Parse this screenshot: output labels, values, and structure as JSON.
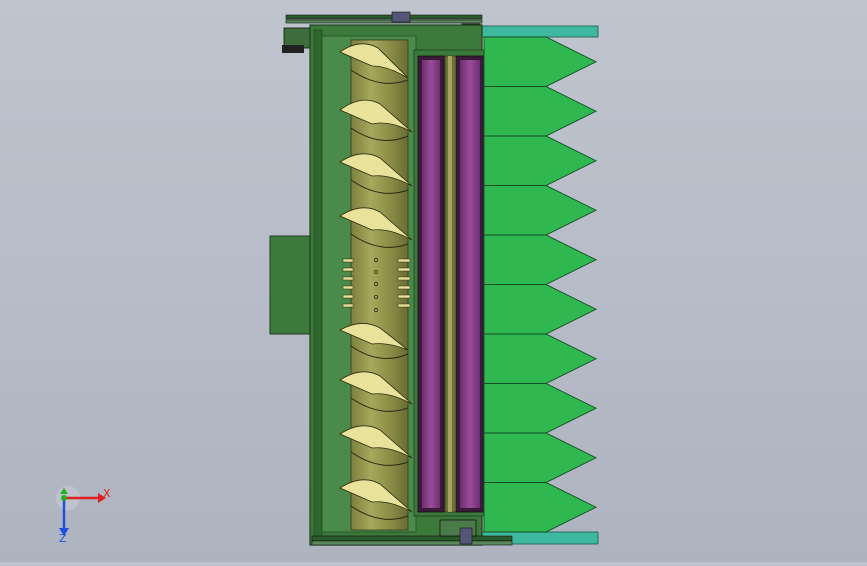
{
  "viewport": {
    "background_top": "#bfc4ce",
    "background_bottom": "#aeb3c0"
  },
  "model": {
    "colors": {
      "frame": "#3b7a3b",
      "frame_dark": "#1f3f1f",
      "auger": "#8f9148",
      "auger_flight": "#e8e29a",
      "purple": "#8a3f8a",
      "purple_light": "#a85aa8",
      "dividers": "#2fb84f",
      "teal": "#3fb8a0",
      "motor": "#3c7a3c"
    },
    "divider_count": 10,
    "icons": [
      "cad-axis-triad-icon"
    ]
  },
  "triad": {
    "x_label": "X",
    "z_label": "Z",
    "x_color": "#e02020",
    "y_color": "#20b020",
    "z_color": "#2050e0"
  }
}
